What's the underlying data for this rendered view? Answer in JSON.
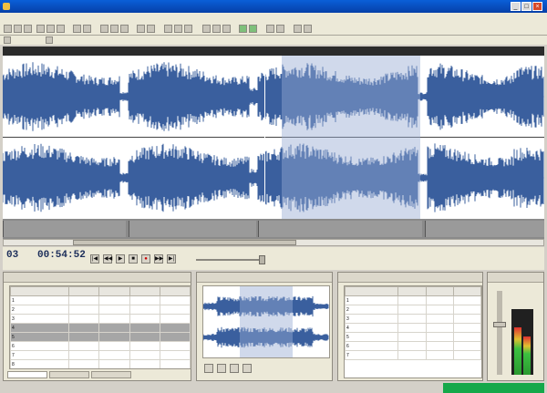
{
  "window": {
    "title": "",
    "controls": [
      "_",
      "□",
      "×"
    ]
  },
  "menus": [
    "",
    "",
    "",
    "",
    "",
    "",
    "",
    "",
    ""
  ],
  "ruler_ticks": [
    "",
    "",
    "",
    "",
    "",
    "",
    "",
    "",
    "",
    "",
    "",
    ""
  ],
  "labels": [
    "",
    "",
    "",
    "",
    ""
  ],
  "transport": {
    "position": "03",
    "time": "00:54:52",
    "buttons": [
      "|◀",
      "◀◀",
      "▶",
      "■",
      "●",
      "▶▶",
      "▶|"
    ],
    "rate_label": ""
  },
  "tracklist": {
    "title": "",
    "headers": [
      "",
      "",
      "",
      "",
      ""
    ],
    "rows": [
      [
        "1",
        "",
        "",
        "",
        ""
      ],
      [
        "2",
        "",
        "",
        "",
        ""
      ],
      [
        "3",
        "",
        "",
        "",
        ""
      ],
      [
        "4",
        "",
        "",
        "",
        ""
      ],
      [
        "5",
        "",
        "",
        "",
        ""
      ],
      [
        "6",
        "",
        "",
        "",
        ""
      ],
      [
        "7",
        "",
        "",
        "",
        ""
      ],
      [
        "8",
        "",
        "",
        "",
        ""
      ]
    ],
    "tabs": [
      "",
      "",
      ""
    ]
  },
  "preview": {
    "title": ""
  },
  "playlist": {
    "title": "",
    "headers": [
      "",
      "",
      "",
      ""
    ],
    "rows": [
      [
        "1",
        "",
        "",
        ""
      ],
      [
        "2",
        "",
        "",
        ""
      ],
      [
        "3",
        "",
        "",
        ""
      ],
      [
        "4",
        "",
        "",
        ""
      ],
      [
        "5",
        "",
        "",
        ""
      ],
      [
        "6",
        "",
        "",
        ""
      ],
      [
        "7",
        "",
        "",
        ""
      ]
    ]
  },
  "meters": {
    "title": "",
    "left_level": 0.72,
    "right_level": 0.58
  },
  "status": "",
  "colors": {
    "wave": "#3a5f9e",
    "wave_selected": "#8d9fc8",
    "status_green": "#15a84a"
  }
}
